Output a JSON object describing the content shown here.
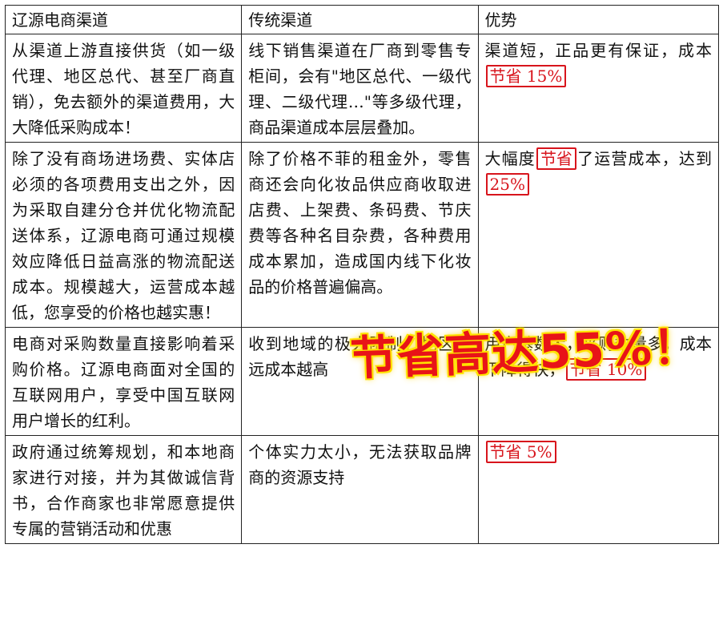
{
  "headers": [
    "辽源电商渠道",
    "传统渠道",
    "优势"
  ],
  "rows": [
    {
      "ecommerce": "从渠道上游直接供货（如一级代理、地区总代、甚至厂商直销），免去额外的渠道费用，大大降低采购成本！",
      "traditional": "线下销售渠道在厂商到零售专柜间，会有\"地区总代、一级代理、二级代理…\"等多级代理，商品渠道成本层层叠加。",
      "advantage_pre": "渠道短，正品更有保证，成本",
      "advantage_hl": "节省 15%",
      "advantage_post": ""
    },
    {
      "ecommerce": "除了没有商场进场费、实体店必须的各项费用支出之外，因为采取自建分仓并优化物流配送体系，辽源电商可通过规模效应降低日益高涨的物流配送成本。规模越大，运营成本越低，您享受的价格也越实惠！",
      "traditional": "除了价格不菲的租金外，零售商还会向化妆品供应商收取进店费、上架费、条码费、节庆费等各种名目杂费，各种费用成本累加，造成国内线下化妆品的价格普遍偏高。",
      "advantage_pre": "大幅度",
      "advantage_hl": "节省",
      "advantage_mid": "了运营成本，达到",
      "advantage_hl2": "25%"
    },
    {
      "ecommerce": "电商对采购数量直接影响着采购价格。辽源电商面对全国的互联网用户，享受中国互联网用户增长的红利。",
      "traditional": "收到地域的极大限制，地区越远成本越高",
      "advantage_pre": "用户基数大，采购数量多，成本下降得快，",
      "advantage_hl": "节省 10%",
      "advantage_post": ""
    },
    {
      "ecommerce": "政府通过统筹规划，和本地商家进行对接，并为其做诚信背书，合作商家也非常愿意提供专属的营销活动和优惠",
      "traditional": "个体实力太小，无法获取品牌商的资源支持",
      "advantage_pre": "",
      "advantage_hl": "节省 5%",
      "advantage_post": ""
    }
  ],
  "overlay_text": "节省高达55%！",
  "colors": {
    "highlight": "#d8141c",
    "overlay": "#e81318",
    "overlay_glow": "#ffe200"
  }
}
